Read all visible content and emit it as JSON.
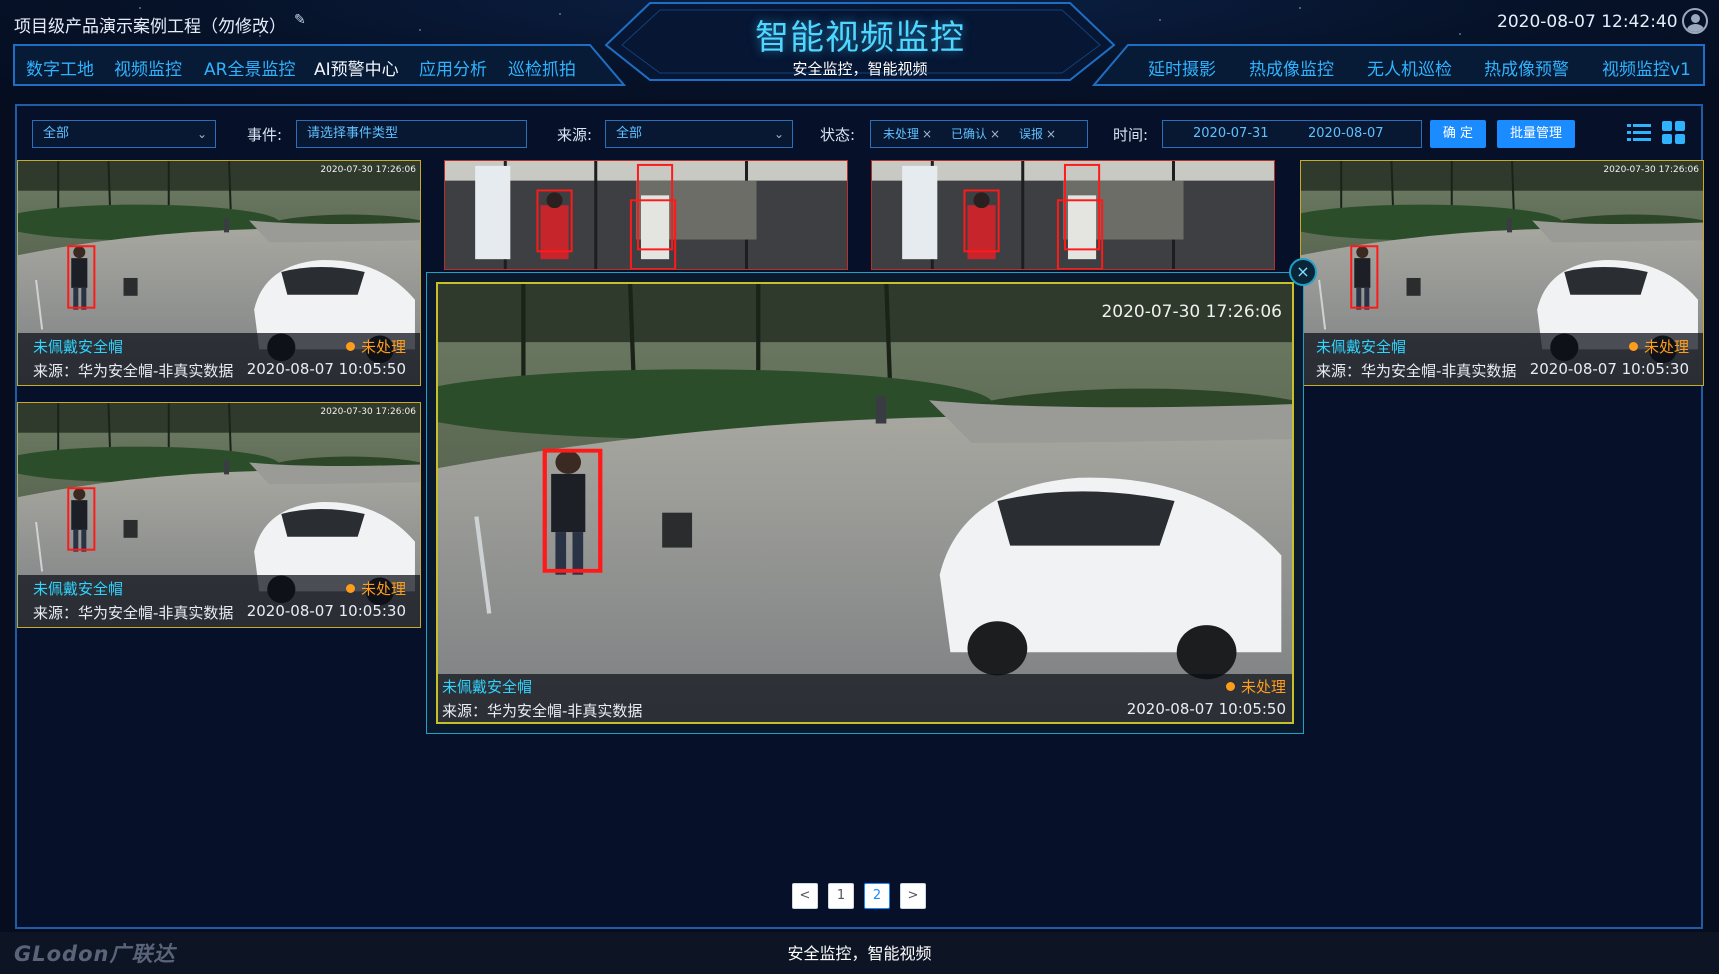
{
  "header": {
    "project_title": "项目级产品演示案例工程（勿修改）",
    "project_edit_icon": "pen-icon",
    "title": "智能视频监控",
    "subtitle": "安全监控，智能视频",
    "datetime": "2020-08-07 12:42:40",
    "user_icon": "user-avatar-icon",
    "nav_left": [
      "数字工地",
      "视频监控",
      "AR全景监控",
      "AI预警中心",
      "应用分析",
      "巡检抓拍"
    ],
    "nav_left_active": "AI预警中心",
    "nav_right": [
      "延时摄影",
      "热成像监控",
      "无人机巡检",
      "热成像预警",
      "视频监控v1"
    ]
  },
  "filters": {
    "scope_value": "全部",
    "event_label": "事件:",
    "event_placeholder": "请选择事件类型",
    "source_label": "来源:",
    "source_value": "全部",
    "status_label": "状态:",
    "status_tags": [
      "未处理",
      "已确认",
      "误报"
    ],
    "time_label": "时间:",
    "time_start": "2020-07-31",
    "time_end": "2020-08-07",
    "confirm_button": "确 定",
    "batch_button": "批量管理",
    "view_list_icon": "list-view-icon",
    "view_grid_icon": "grid-view-icon"
  },
  "cards": [
    {
      "title": "未佩戴安全帽",
      "status": "未处理",
      "source": "来源：华为安全帽-非真实数据",
      "time": "2020-08-07 10:05:50",
      "stamp": "2020-07-30 17:26:06"
    },
    {
      "title": "未佩戴安全帽",
      "status": "未处理",
      "source": "来源：华为安全帽-非真实数据",
      "time": "2020-08-07 10:05:30",
      "stamp": "2020-07-30 17:26:06"
    },
    {
      "title": "未佩戴安全帽",
      "status": "未处理",
      "source": "来源：华为安全帽-非真实数据",
      "time": "2020-08-07 10:05:30",
      "stamp": "2020-07-30 17:26:06"
    }
  ],
  "popup": {
    "title": "未佩戴安全帽",
    "status": "未处理",
    "source": "来源：华为安全帽-非真实数据",
    "time": "2020-08-07 10:05:50",
    "stamp": "2020-07-30 17:26:06",
    "close_icon": "close-icon"
  },
  "pagination": {
    "prev": "<",
    "pages": [
      "1",
      "2"
    ],
    "current": "2",
    "next": ">"
  },
  "footer": {
    "text": "安全监控，智能视频",
    "brand": "GLodon广联达"
  },
  "colors": {
    "accent": "#2fb3ff",
    "title": "#4fd8ff",
    "status_pending": "#ff9d1a",
    "button": "#1a8cff",
    "border": "#1e5da6"
  }
}
